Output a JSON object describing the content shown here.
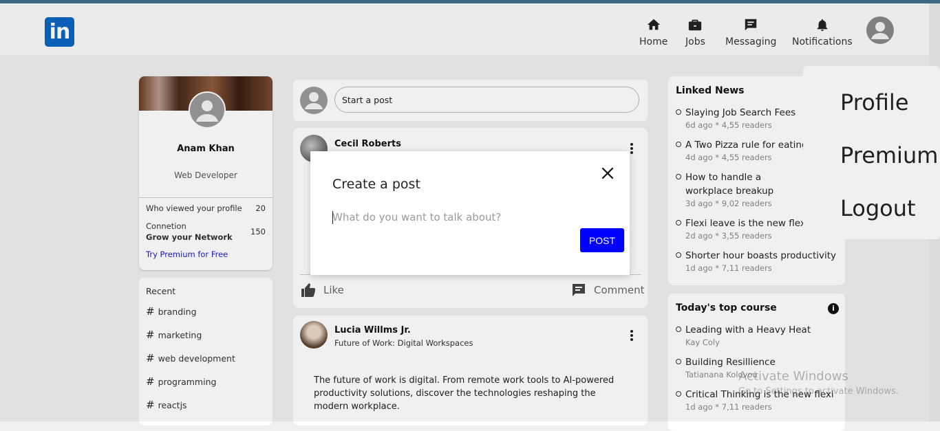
{
  "header": {
    "logo_text": "in",
    "nav": [
      {
        "label": "Home",
        "icon": "home-icon"
      },
      {
        "label": "Jobs",
        "icon": "briefcase-icon"
      },
      {
        "label": "Messaging",
        "icon": "message-icon"
      },
      {
        "label": "Notifications",
        "icon": "bell-icon"
      }
    ]
  },
  "profile": {
    "name": "Anam Khan",
    "title": "Web Developer",
    "viewed_label": "Who viewed your profile",
    "viewed_count": "20",
    "connection_label": "Connetion",
    "grow_label": "Grow your Network",
    "connection_count": "150",
    "premium_link": "Try Premium for Free"
  },
  "recent": {
    "title": "Recent",
    "tags": [
      "branding",
      "marketing",
      "web development",
      "programming",
      "reactjs"
    ]
  },
  "feed": {
    "start_post_label": "Start a post",
    "posts": [
      {
        "author": "Cecil Roberts",
        "subtitle": "",
        "text": "",
        "like_label": "Like",
        "comment_label": "Comment"
      },
      {
        "author": "Lucia Willms Jr.",
        "subtitle": "Future of Work: Digital Workspaces",
        "text": "The future of work is digital. From remote work tools to AI-powered productivity solutions, discover the technologies reshaping the modern workplace."
      }
    ]
  },
  "news": {
    "title": "Linked News",
    "items": [
      {
        "title": "Slaying Job Search Fees",
        "meta": "6d ago * 4,55 readers"
      },
      {
        "title": "A Two Pizza rule for eating",
        "meta": "4d ago * 4,55 readers"
      },
      {
        "title": "How to handle a workplace breakup",
        "meta": "3d ago * 9,02 readers"
      },
      {
        "title": "Flexi leave is the new flexi",
        "meta": "2d ago * 3,55 readers"
      },
      {
        "title": "Shorter hour boasts productivity",
        "meta": "1d ago * 7,11 readers"
      }
    ]
  },
  "courses": {
    "title": "Today's top course",
    "items": [
      {
        "title": "Leading with a Heavy Heat",
        "meta": "Kay Coly"
      },
      {
        "title": "Building Resillience",
        "meta": "Tatianana Kolovou"
      },
      {
        "title": "Critical Thinking is the new flexi",
        "meta": "1d ago * 7,11 readers"
      }
    ]
  },
  "menu": {
    "items": [
      "Profile",
      "Premium",
      "Logout"
    ]
  },
  "modal": {
    "title": "Create a post",
    "placeholder": "What do you want to talk about?",
    "post_button": "POST"
  },
  "watermark": {
    "line1": "Activate Windows",
    "line2": "Go to Settings to activate Windows."
  },
  "colors": {
    "brand": "#0a66c2",
    "post_button": "#0000ff",
    "premium_link": "#1d1dc5"
  }
}
